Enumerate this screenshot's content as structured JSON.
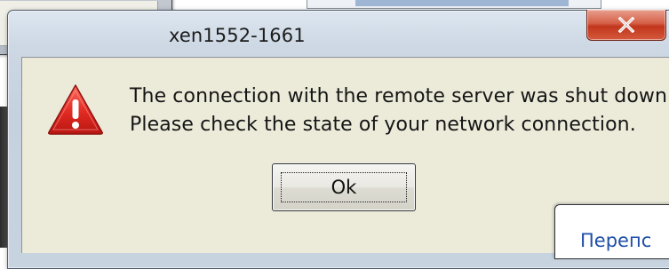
{
  "dialog": {
    "title": "xen1552-1661",
    "message_line_1": "The connection with the remote server was shut down.",
    "message_line_2": "Please check the state of your network connection.",
    "ok_label": "Ok",
    "icon": "warning-icon",
    "close_icon": "close-icon"
  },
  "background_window": {
    "partial_text": "Перепс"
  },
  "colors": {
    "warning_red": "#d81e1e",
    "close_button_red": "#c1361c",
    "dialog_face": "#ecead9",
    "link_blue": "#1e4fa8"
  }
}
